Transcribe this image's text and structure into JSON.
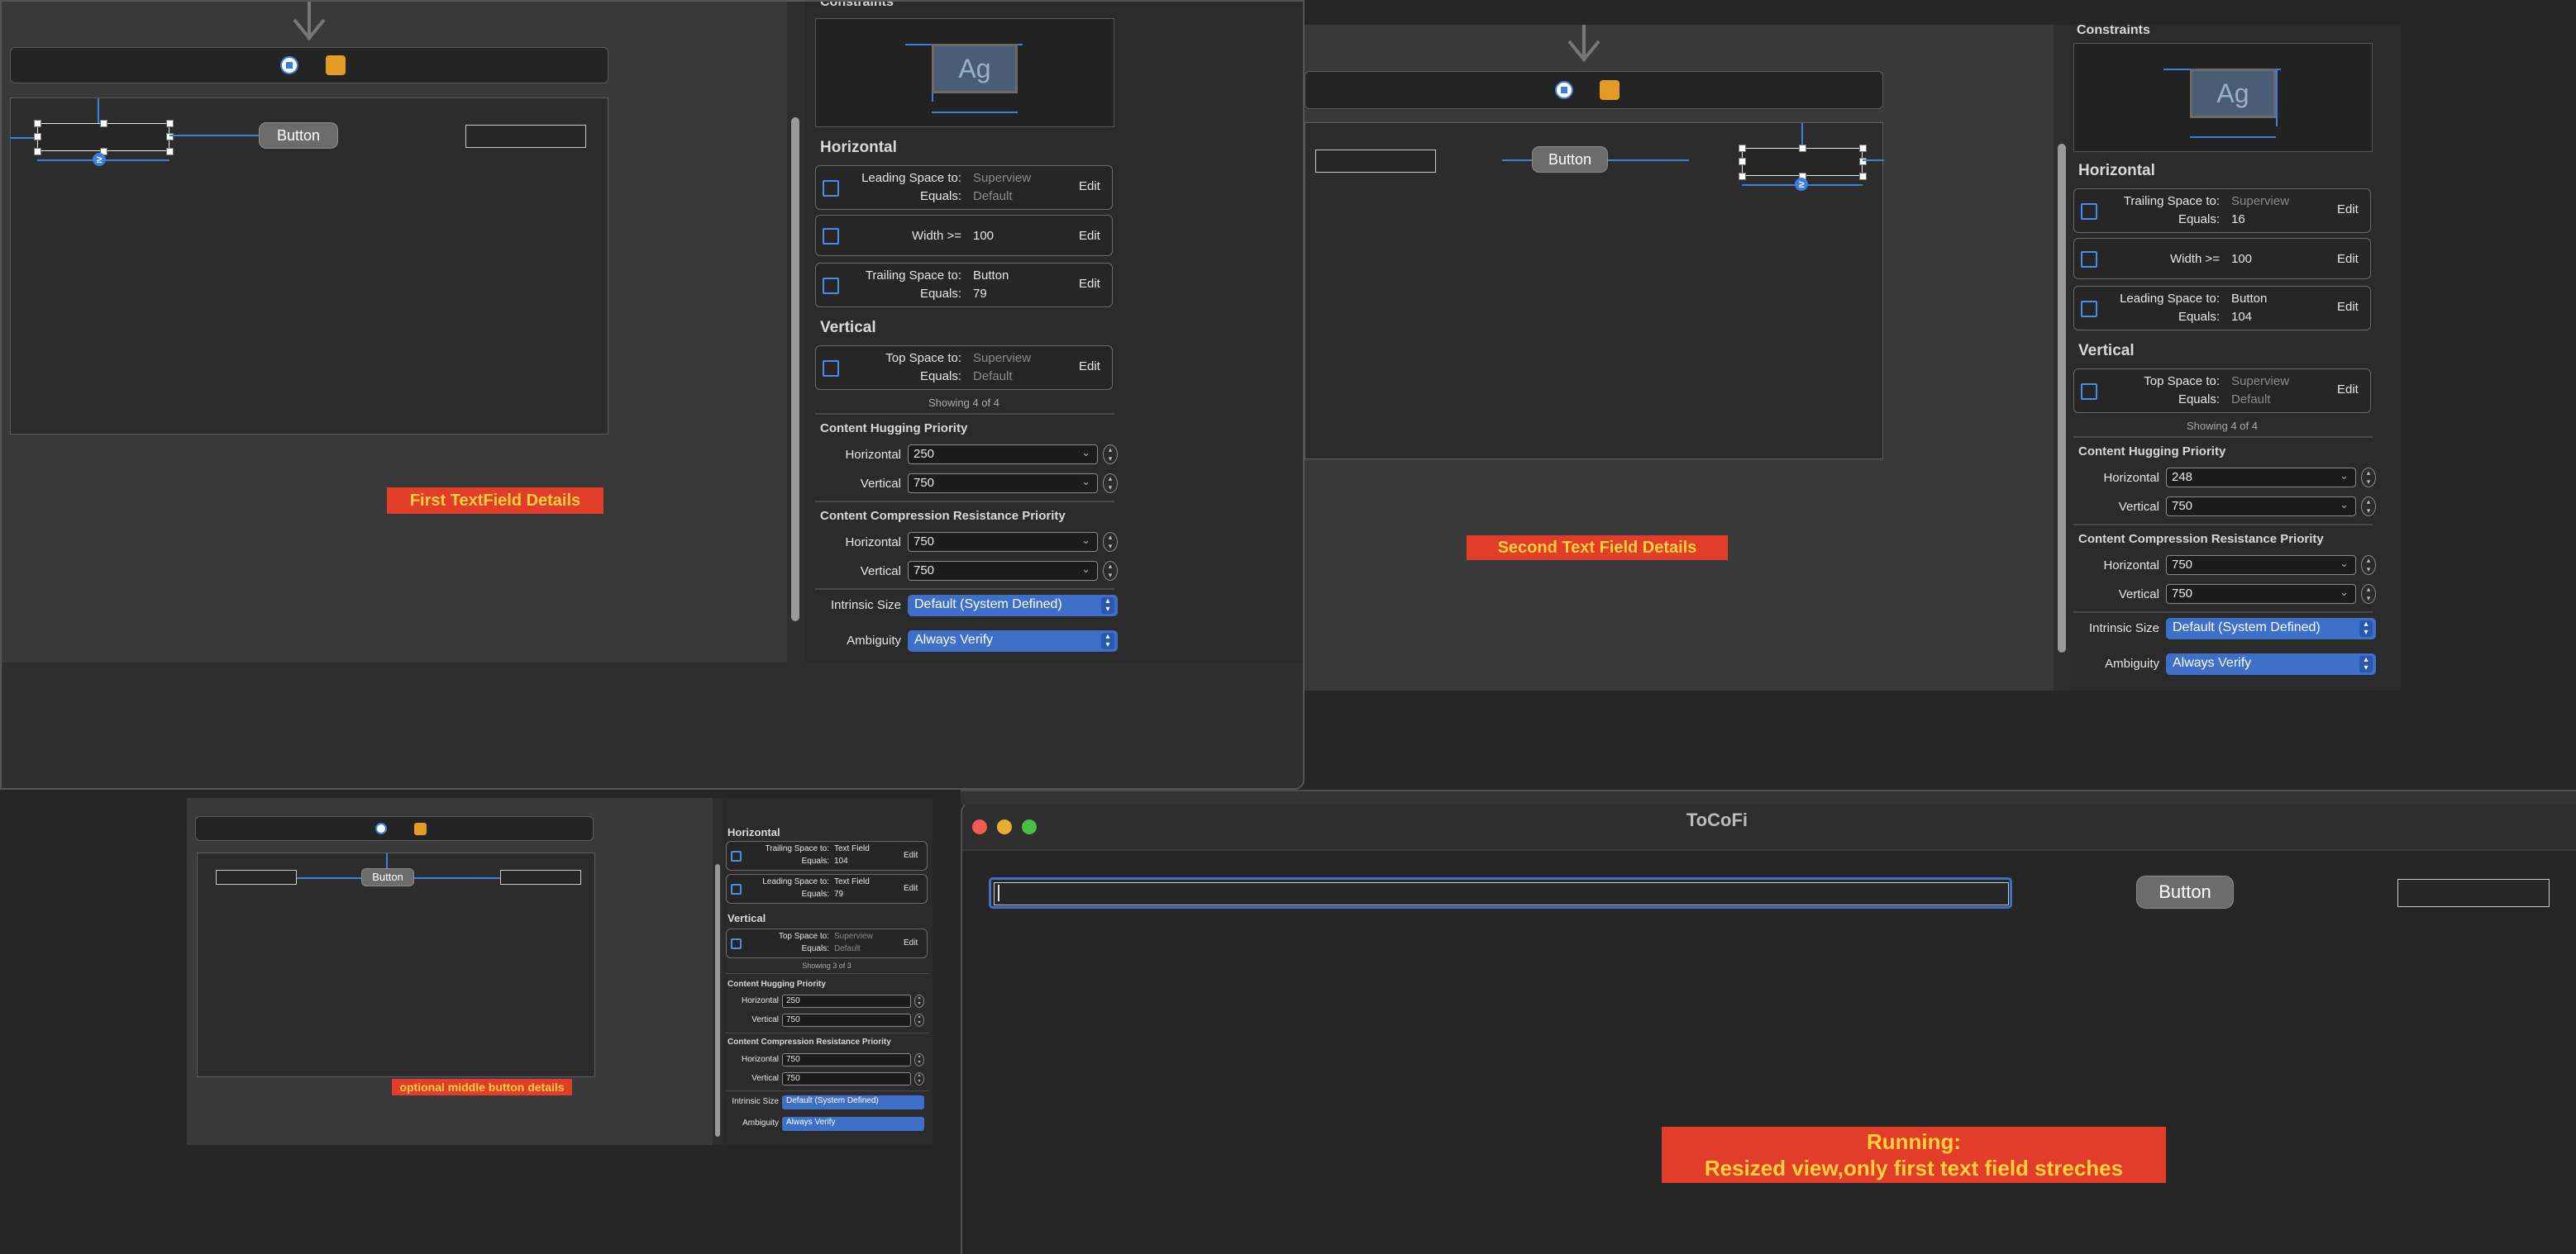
{
  "panel1": {
    "constraints_title": "Constraints",
    "ag_label": "Ag",
    "button_label": "Button",
    "badge": "≥",
    "horizontal_title": "Horizontal",
    "vertical_title": "Vertical",
    "h_rows": [
      {
        "label1": "Leading Space to:",
        "value1": "Superview",
        "label2": "Equals:",
        "value2": "Default",
        "edit": "Edit"
      },
      {
        "label1": "Width >=",
        "value1": "100",
        "edit": "Edit"
      },
      {
        "label1": "Trailing Space to:",
        "value1": "Button",
        "label2": "Equals:",
        "value2": "79",
        "edit": "Edit"
      }
    ],
    "v_rows": [
      {
        "label1": "Top Space to:",
        "value1": "Superview",
        "label2": "Equals:",
        "value2": "Default",
        "edit": "Edit"
      }
    ],
    "showing": "Showing 4 of 4",
    "hugging_title": "Content Hugging Priority",
    "hugging_h_label": "Horizontal",
    "hugging_h": "250",
    "hugging_v_label": "Vertical",
    "hugging_v": "750",
    "compression_title": "Content Compression Resistance Priority",
    "comp_h_label": "Horizontal",
    "comp_h": "750",
    "comp_v_label": "Vertical",
    "comp_v": "750",
    "intrinsic_label": "Intrinsic Size",
    "intrinsic_value": "Default (System Defined)",
    "ambiguity_label": "Ambiguity",
    "ambiguity_value": "Always Verify",
    "caption": "First  TextField Details"
  },
  "panel2": {
    "constraints_title": "Constraints",
    "ag_label": "Ag",
    "button_label": "Button",
    "badge": "≥",
    "horizontal_title": "Horizontal",
    "vertical_title": "Vertical",
    "h_rows": [
      {
        "label1": "Trailing Space to:",
        "value1": "Superview",
        "label2": "Equals:",
        "value2": "16",
        "edit": "Edit"
      },
      {
        "label1": "Width >=",
        "value1": "100",
        "edit": "Edit"
      },
      {
        "label1": "Leading Space to:",
        "value1": "Button",
        "label2": "Equals:",
        "value2": "104",
        "edit": "Edit"
      }
    ],
    "v_rows": [
      {
        "label1": "Top Space to:",
        "value1": "Superview",
        "label2": "Equals:",
        "value2": "Default",
        "edit": "Edit"
      }
    ],
    "showing": "Showing 4 of 4",
    "hugging_title": "Content Hugging Priority",
    "hugging_h_label": "Horizontal",
    "hugging_h": "248",
    "hugging_v_label": "Vertical",
    "hugging_v": "750",
    "compression_title": "Content Compression Resistance Priority",
    "comp_h_label": "Horizontal",
    "comp_h": "750",
    "comp_v_label": "Vertical",
    "comp_v": "750",
    "intrinsic_label": "Intrinsic Size",
    "intrinsic_value": "Default (System Defined)",
    "ambiguity_label": "Ambiguity",
    "ambiguity_value": "Always Verify",
    "caption": "Second Text Field Details"
  },
  "panel3": {
    "button_label": "Button",
    "horizontal_title": "Horizontal",
    "vertical_title": "Vertical",
    "h_rows": [
      {
        "label1": "Trailing Space to:",
        "value1": "Text Field",
        "label2": "Equals:",
        "value2": "104",
        "edit": "Edit"
      },
      {
        "label1": "Leading Space to:",
        "value1": "Text Field",
        "label2": "Equals:",
        "value2": "79",
        "edit": "Edit"
      }
    ],
    "v_rows": [
      {
        "label1": "Top Space to:",
        "value1": "Superview",
        "label2": "Equals:",
        "value2": "Default",
        "edit": "Edit"
      }
    ],
    "showing": "Showing 3 of 3",
    "hugging_title": "Content Hugging Priority",
    "hugging_h_label": "Horizontal",
    "hugging_h": "250",
    "hugging_v_label": "Vertical",
    "hugging_v": "750",
    "compression_title": "Content Compression Resistance Priority",
    "comp_h_label": "Horizontal",
    "comp_h": "750",
    "comp_v_label": "Vertical",
    "comp_v": "750",
    "intrinsic_label": "Intrinsic Size",
    "intrinsic_value": "Default (System Defined)",
    "ambiguity_label": "Ambiguity",
    "ambiguity_value": "Always Verify",
    "caption": "optional middle button details"
  },
  "running": {
    "window_title": "ToCoFi",
    "button_label": "Button",
    "caption_line1": "Running:",
    "caption_line2": "Resized view,only first text field streches"
  },
  "colors": {
    "accent": "#3c7de0",
    "caption_bg": "#e23c2a",
    "caption_text": "#ffd23a"
  }
}
